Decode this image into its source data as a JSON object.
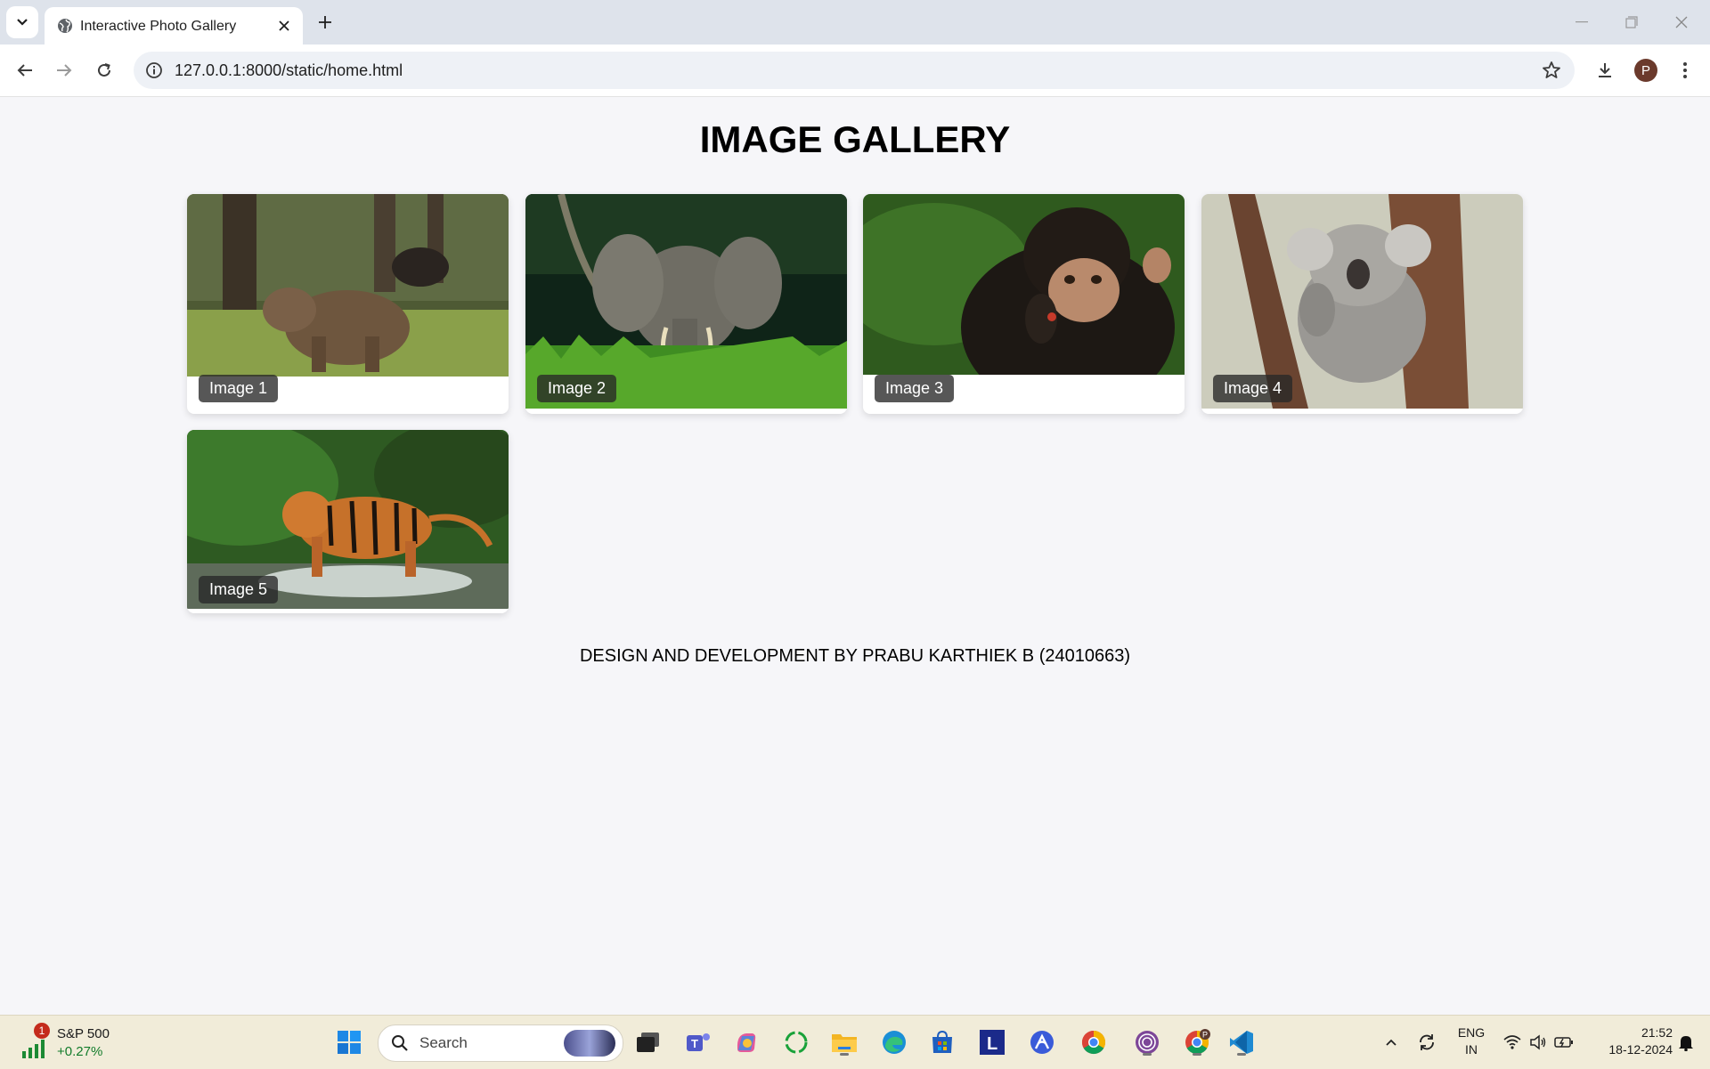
{
  "browser": {
    "tab_title": "Interactive Photo Gallery",
    "url": "127.0.0.1:8000/static/home.html",
    "profile_initial": "P"
  },
  "page": {
    "heading": "IMAGE GALLERY",
    "images": [
      {
        "caption": "Image 1",
        "subject": "brown bear in forest"
      },
      {
        "caption": "Image 2",
        "subject": "elephant in grass"
      },
      {
        "caption": "Image 3",
        "subject": "chimpanzee"
      },
      {
        "caption": "Image 4",
        "subject": "koala on tree"
      },
      {
        "caption": "Image 5",
        "subject": "tiger in stream"
      }
    ],
    "footer": "DESIGN AND DEVELOPMENT BY PRABU KARTHIEK B (24010663)"
  },
  "taskbar": {
    "stock_badge": "1",
    "stock_name": "S&P 500",
    "stock_change": "+0.27%",
    "search_placeholder": "Search",
    "lang_line1": "ENG",
    "lang_line2": "IN",
    "time": "21:52",
    "date": "18-12-2024",
    "pinned_apps": [
      "start-icon",
      "search",
      "file-explorer-dark-icon",
      "teams-icon",
      "copilot-icon",
      "refresh-green-icon",
      "file-explorer-icon",
      "edge-icon",
      "store-icon",
      "l-app-icon",
      "arc-icon",
      "chrome-icon",
      "tor-icon",
      "chrome-profile-icon",
      "vscode-icon"
    ]
  },
  "colors": {
    "page_bg": "#f6f6f9",
    "caption_bg": "#333333",
    "taskbar_bg": "#f1ecd9",
    "tabstrip_bg": "#dee3eb"
  }
}
